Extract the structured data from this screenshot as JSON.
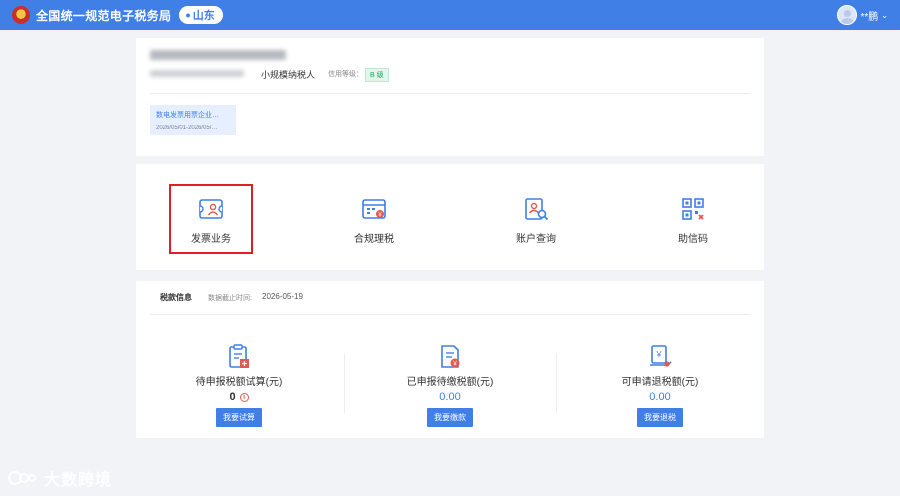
{
  "header": {
    "app_title": "全国统一规范电子税务局",
    "region": "山东",
    "username": "**鹏"
  },
  "company": {
    "taxpayer_type": "小规模纳税人",
    "credit_label": "信用等级：",
    "credit_level": "B 级"
  },
  "invoice_tag": {
    "title": "数电发票用票企业…",
    "period": "2026/05/01-2026/05/…"
  },
  "services": [
    {
      "label": "发票业务",
      "icon": "invoice-icon",
      "selected": true
    },
    {
      "label": "合规理税",
      "icon": "calendar-tax-icon",
      "selected": false
    },
    {
      "label": "账户查询",
      "icon": "account-search-icon",
      "selected": false
    },
    {
      "label": "助信码",
      "icon": "qr-code-icon",
      "selected": false
    }
  ],
  "tax_info": {
    "title": "税款信息",
    "date_label": "数据截止时间:",
    "date": "2026-05-19",
    "items": [
      {
        "label": "待申报税额试算(元)",
        "value": "0",
        "button": "我要试算",
        "icon": "clipboard-calc-icon"
      },
      {
        "label": "已申报待缴税额(元)",
        "value": "0.00",
        "button": "我要缴款",
        "icon": "tax-doc-icon"
      },
      {
        "label": "可申请退税额(元)",
        "value": "0.00",
        "button": "我要退税",
        "icon": "refund-icon"
      }
    ]
  },
  "watermark": "大数跨境",
  "colors": {
    "primary": "#3f7fe6",
    "highlight": "#e02020",
    "icon_red": "#e05a4f"
  }
}
